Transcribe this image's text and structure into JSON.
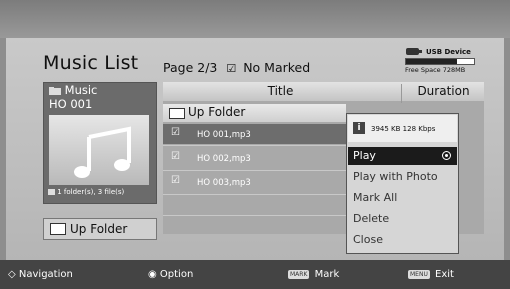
{
  "header": {
    "title": "Music List",
    "page_info": "Page 2/3",
    "check_glyph": "☑",
    "marked_text": "No Marked"
  },
  "usb": {
    "label": "USB Device",
    "free_space": "Free Space 728MB",
    "used_fraction": 0.75
  },
  "preview": {
    "folder_label": "Music",
    "track_name": "HO 001",
    "counts": "1 folder(s), 3 file(s)"
  },
  "up_folder_button": {
    "label": "Up Folder"
  },
  "list": {
    "columns": [
      "Title",
      "Duration"
    ],
    "up_folder_label": "Up Folder",
    "items": [
      {
        "check": "☑",
        "name": "HO 001,mp3"
      },
      {
        "check": "☑",
        "name": "HO 002,mp3"
      },
      {
        "check": "☑",
        "name": "HO 003,mp3"
      }
    ]
  },
  "menu": {
    "info_icon": "i",
    "info_text": "3945 KB 128 Kbps",
    "items": [
      "Play",
      "Play with Photo",
      "Mark All",
      "Delete",
      "Close"
    ]
  },
  "footer": {
    "nav_glyph": "◇",
    "navigation": "Navigation",
    "option_glyph": "◉",
    "option": "Option",
    "mark_badge": "MARK",
    "mark": "Mark",
    "menu_badge": "MENU",
    "exit": "Exit"
  },
  "colors": {
    "panel": "#c0c0c0",
    "selected_row": "#6d6d6d",
    "active_menu": "#1b1b1b",
    "bottom_bar": "#444444"
  }
}
